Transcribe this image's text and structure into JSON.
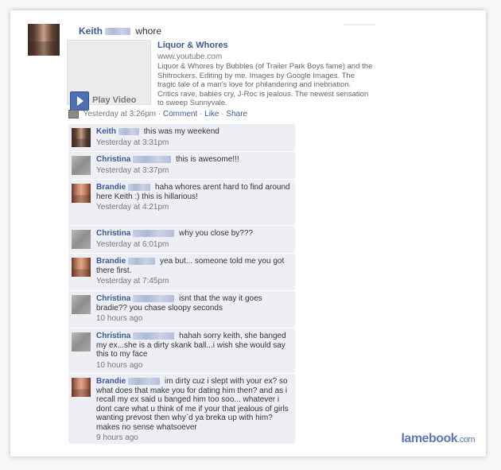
{
  "post": {
    "author": "Keith",
    "action": "whore",
    "link_title": "Liquor & Whores",
    "link_url": "www.youtube.com",
    "link_desc": "Liquor & Whores by Bubbles (of Trailer Park Boys fame) and the Shitrockers. Editing by me. Images by Google Images. The tragic tale of a man's love for philandering and inebriation. Critics rave, babies cry, J-Roc is jealous. The newest sensation to sweep Sunnyvale.",
    "play_label": "Play Video",
    "timestamp": "Yesterday at 3:26pm",
    "actions": {
      "comment": "Comment",
      "like": "Like",
      "share": "Share"
    },
    "separator": "·"
  },
  "comments": [
    {
      "name": "Keith",
      "text": "this was my weekend",
      "time": "Yesterday at 3:31pm"
    },
    {
      "name": "Christina",
      "text": "this is awesome!!!",
      "time": "Yesterday at 3:37pm"
    },
    {
      "name": "Brandie",
      "text": "haha whores arent hard to find around here Keith :) this is hillarious!",
      "time": "Yesterday at 4:21pm"
    },
    {
      "name": "Christina",
      "text": "why you close by???",
      "time": "Yesterday at 6:01pm"
    },
    {
      "name": "Brandie",
      "text": "yea but... someone told me you got there first.",
      "time": "Yesterday at 7:45pm"
    },
    {
      "name": "Christina",
      "text": "isnt that the way it goes bradie?? you chase sloopy seconds",
      "time": "10 hours ago"
    },
    {
      "name": "Christina",
      "text": "hahah sorry keith, she banged my ex...she is a dirty skank ball...i wish she would say this to my face",
      "time": "10 hours ago"
    },
    {
      "name": "Brandie",
      "text": "im dirty cuz i slept with your ex? so what does that make you for dating him then? and as i recall my ex said u banged him too soo... whatever i dont care what u think of me if your that jealous of girls wanting prevost then why`d ya breka up with him? makes no sense whatsoever",
      "time": "9 hours ago"
    }
  ],
  "watermark": {
    "brand": "lamebook",
    "tld": ".com"
  }
}
